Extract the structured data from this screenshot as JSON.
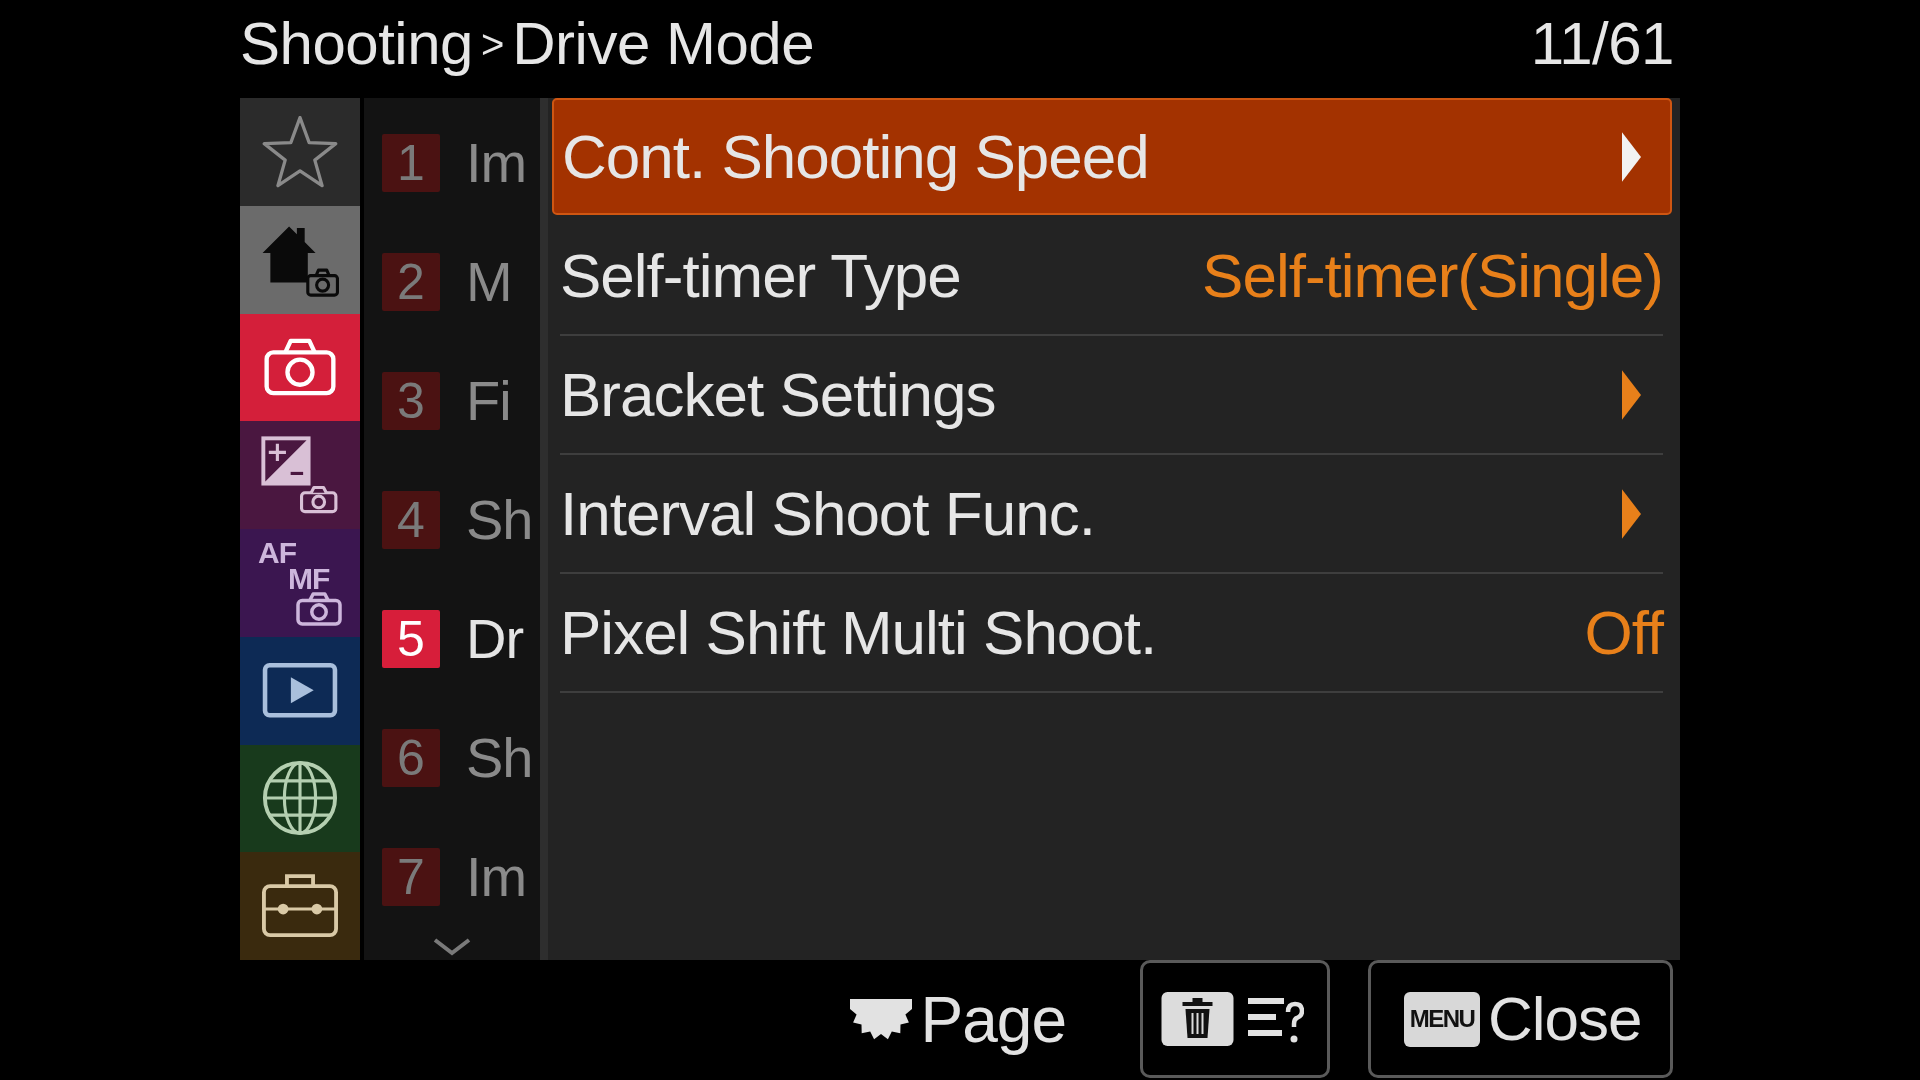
{
  "header": {
    "breadcrumb": [
      "Shooting",
      "Drive Mode"
    ],
    "separator": ">",
    "counter": "11/61"
  },
  "categories": [
    {
      "kind": "star",
      "color": "#2b2b2b",
      "selected": false
    },
    {
      "kind": "home",
      "color": "#6b6b6b",
      "selected": false
    },
    {
      "kind": "camera",
      "color": "#d41f3a",
      "selected": true
    },
    {
      "kind": "exposure",
      "color": "#4a1740",
      "selected": false
    },
    {
      "kind": "focus",
      "color": "#3b1650",
      "selected": false,
      "labels": [
        "AF",
        "MF"
      ]
    },
    {
      "kind": "playback",
      "color": "#0d2a55",
      "selected": false
    },
    {
      "kind": "network",
      "color": "#183a1c",
      "selected": false
    },
    {
      "kind": "setup",
      "color": "#3a2a0e",
      "selected": false
    }
  ],
  "page_list": {
    "more_below": true,
    "items": [
      {
        "number": "1",
        "title": "Im",
        "selected": false
      },
      {
        "number": "2",
        "title": "M",
        "selected": false
      },
      {
        "number": "3",
        "title": "Fi",
        "selected": false
      },
      {
        "number": "4",
        "title": "Sh",
        "selected": false
      },
      {
        "number": "5",
        "title": "Dr",
        "selected": true
      },
      {
        "number": "6",
        "title": "Sh",
        "selected": false
      },
      {
        "number": "7",
        "title": "Im",
        "selected": false
      }
    ]
  },
  "menu": [
    {
      "label": "Cont. Shooting Speed",
      "kind": "submenu",
      "selected": true
    },
    {
      "label": "Self-timer Type",
      "kind": "value",
      "value": "Self-timer(Single)",
      "selected": false
    },
    {
      "label": "Bracket Settings",
      "kind": "submenu",
      "selected": false
    },
    {
      "label": "Interval Shoot Func.",
      "kind": "submenu",
      "selected": false
    },
    {
      "label": "Pixel Shift Multi Shoot.",
      "kind": "value",
      "value": "Off",
      "selected": false
    }
  ],
  "footer": {
    "hint": "Page",
    "buttons": [
      {
        "kind": "delete-help"
      },
      {
        "kind": "close",
        "key": "MENU",
        "label": "Close"
      }
    ]
  }
}
